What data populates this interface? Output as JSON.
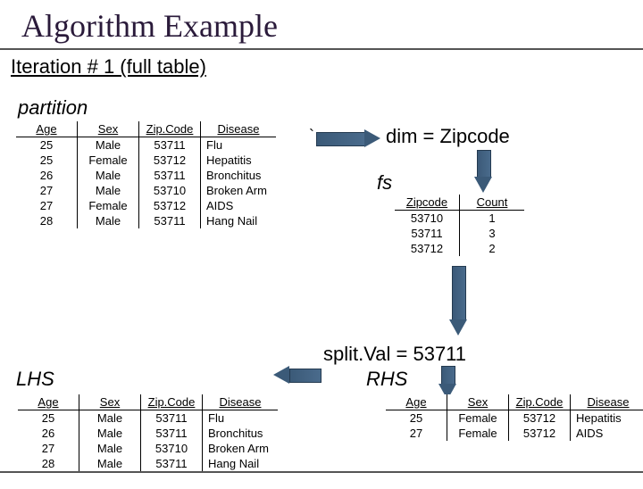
{
  "title": "Algorithm Example",
  "subtitle": "Iteration # 1 (full table)",
  "labels": {
    "partition": "partition",
    "dim": "dim = Zipcode",
    "fs": "fs",
    "splitVal": "split.Val = 53711",
    "lhs": "LHS",
    "rhs": "RHS"
  },
  "chart_data": [
    {
      "type": "table",
      "name": "partition",
      "columns": [
        "Age",
        "Sex",
        "Zip.Code",
        "Disease"
      ],
      "rows": [
        [
          "25",
          "Male",
          "53711",
          "Flu"
        ],
        [
          "25",
          "Female",
          "53712",
          "Hepatitis"
        ],
        [
          "26",
          "Male",
          "53711",
          "Bronchitus"
        ],
        [
          "27",
          "Male",
          "53710",
          "Broken Arm"
        ],
        [
          "27",
          "Female",
          "53712",
          "AIDS"
        ],
        [
          "28",
          "Male",
          "53711",
          "Hang Nail"
        ]
      ]
    },
    {
      "type": "table",
      "name": "fs",
      "columns": [
        "Zipcode",
        "Count"
      ],
      "rows": [
        [
          "53710",
          "1"
        ],
        [
          "53711",
          "3"
        ],
        [
          "53712",
          "2"
        ]
      ]
    },
    {
      "type": "table",
      "name": "lhs",
      "columns": [
        "Age",
        "Sex",
        "Zip.Code",
        "Disease"
      ],
      "rows": [
        [
          "25",
          "Male",
          "53711",
          "Flu"
        ],
        [
          "26",
          "Male",
          "53711",
          "Bronchitus"
        ],
        [
          "27",
          "Male",
          "53710",
          "Broken Arm"
        ],
        [
          "28",
          "Male",
          "53711",
          "Hang Nail"
        ]
      ]
    },
    {
      "type": "table",
      "name": "rhs",
      "columns": [
        "Age",
        "Sex",
        "Zip.Code",
        "Disease"
      ],
      "rows": [
        [
          "25",
          "Female",
          "53712",
          "Hepatitis"
        ],
        [
          "27",
          "Female",
          "53712",
          "AIDS"
        ]
      ]
    }
  ]
}
